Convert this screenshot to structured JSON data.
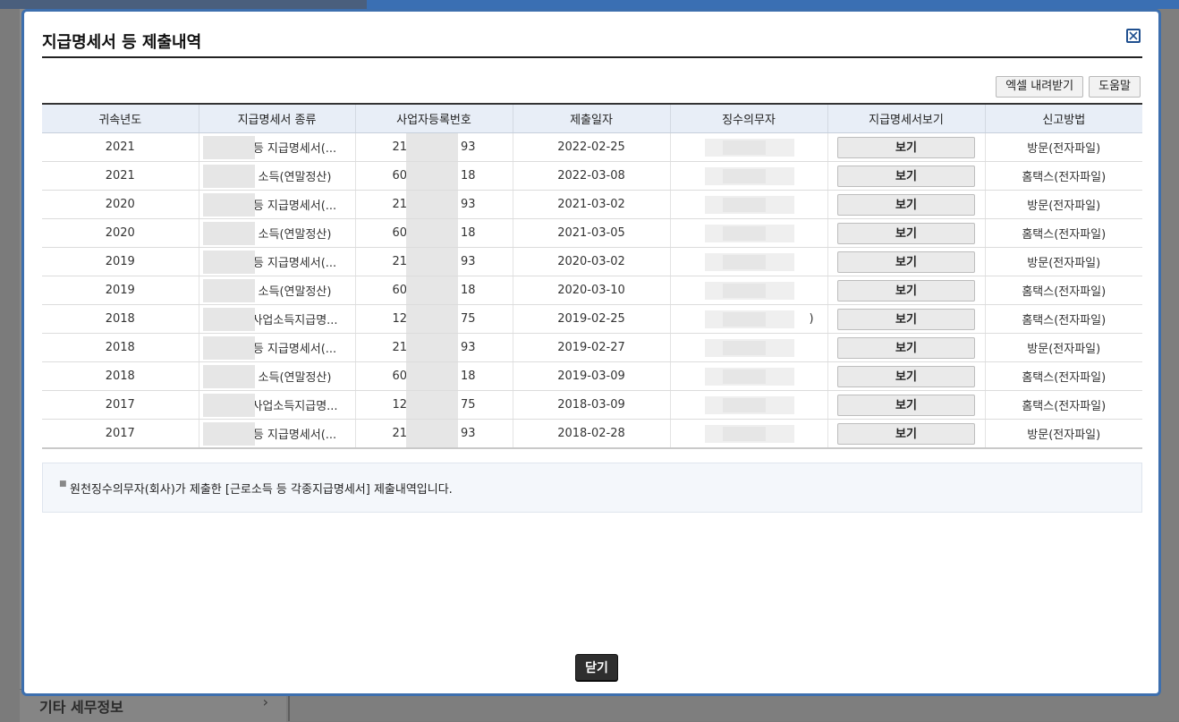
{
  "background": {
    "sidebar_item": "기타 세무정보"
  },
  "modal": {
    "title": "지급명세서 등 제출내역",
    "toolbar": {
      "excel_label": "엑셀 내려받기",
      "help_label": "도움말"
    },
    "columns": [
      "귀속년도",
      "지급명세서 종류",
      "사업자등록번호",
      "제출일자",
      "징수의무자",
      "지급명세서보기",
      "신고방법"
    ],
    "rows": [
      {
        "year": "2021",
        "type": "등 지급명세서(...",
        "bizno_prefix": "21",
        "bizno_suffix": "93",
        "date": "2022-02-25",
        "agent": "",
        "view": "보기",
        "method": "방문(전자파일)"
      },
      {
        "year": "2021",
        "type": "소득(연말정산)",
        "bizno_prefix": "60",
        "bizno_suffix": "18",
        "date": "2022-03-08",
        "agent": "",
        "view": "보기",
        "method": "홈택스(전자파일)"
      },
      {
        "year": "2020",
        "type": "등 지급명세서(...",
        "bizno_prefix": "21",
        "bizno_suffix": "93",
        "date": "2021-03-02",
        "agent": "",
        "view": "보기",
        "method": "방문(전자파일)"
      },
      {
        "year": "2020",
        "type": "소득(연말정산)",
        "bizno_prefix": "60",
        "bizno_suffix": "18",
        "date": "2021-03-05",
        "agent": "",
        "view": "보기",
        "method": "홈택스(전자파일)"
      },
      {
        "year": "2019",
        "type": "등 지급명세서(...",
        "bizno_prefix": "21",
        "bizno_suffix": "93",
        "date": "2020-03-02",
        "agent": "",
        "view": "보기",
        "method": "방문(전자파일)"
      },
      {
        "year": "2019",
        "type": "소득(연말정산)",
        "bizno_prefix": "60",
        "bizno_suffix": "18",
        "date": "2020-03-10",
        "agent": "",
        "view": "보기",
        "method": "홈택스(전자파일)"
      },
      {
        "year": "2018",
        "type": "사업소득지급명...",
        "bizno_prefix": "12",
        "bizno_suffix": "75",
        "date": "2019-02-25",
        "agent": ")",
        "view": "보기",
        "method": "홈택스(전자파일)"
      },
      {
        "year": "2018",
        "type": "등 지급명세서(...",
        "bizno_prefix": "21",
        "bizno_suffix": "93",
        "date": "2019-02-27",
        "agent": "",
        "view": "보기",
        "method": "방문(전자파일)"
      },
      {
        "year": "2018",
        "type": "소득(연말정산)",
        "bizno_prefix": "60",
        "bizno_suffix": "18",
        "date": "2019-03-09",
        "agent": "",
        "view": "보기",
        "method": "홈택스(전자파일)"
      },
      {
        "year": "2017",
        "type": "사업소득지급명...",
        "bizno_prefix": "12",
        "bizno_suffix": "75",
        "date": "2018-03-09",
        "agent": "",
        "view": "보기",
        "method": "홈택스(전자파일)"
      },
      {
        "year": "2017",
        "type": "등 지급명세서(...",
        "bizno_prefix": "21",
        "bizno_suffix": "93",
        "date": "2018-02-28",
        "agent": "",
        "view": "보기",
        "method": "방문(전자파일)"
      }
    ],
    "note": "원천징수의무자(회사)가 제출한 [근로소득 등 각종지급명세서] 제출내역입니다.",
    "close_label": "닫기"
  }
}
